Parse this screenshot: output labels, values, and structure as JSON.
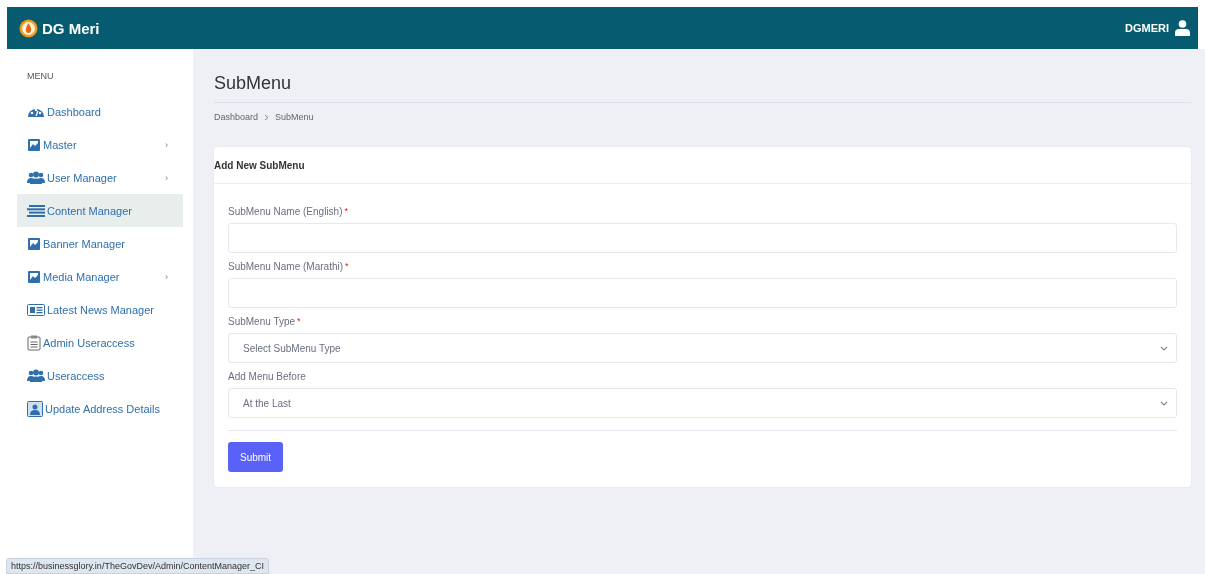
{
  "topbar": {
    "brand": "DG Meri",
    "user": "DGMERI"
  },
  "sidebar": {
    "heading": "MENU",
    "items": [
      {
        "label": "Dashboard",
        "kind": "gauge",
        "selected": false
      },
      {
        "label": "Master",
        "kind": "doc",
        "selected": false,
        "arrow": "›"
      },
      {
        "label": "User Manager",
        "kind": "users",
        "selected": false,
        "arrow": "›"
      },
      {
        "label": "Content Manager",
        "kind": "lines",
        "selected": true
      },
      {
        "label": "Banner Manager",
        "kind": "doc",
        "selected": false
      },
      {
        "label": "Media Manager",
        "kind": "doc",
        "selected": false,
        "arrow": "›"
      },
      {
        "label": "Latest News Manager",
        "kind": "news",
        "selected": false
      },
      {
        "label": "Admin Useraccess",
        "kind": "clipboard",
        "selected": false
      },
      {
        "label": "Useraccess",
        "kind": "users",
        "selected": false
      },
      {
        "label": "Update Address Details",
        "kind": "badge",
        "selected": false
      }
    ]
  },
  "page": {
    "title": "SubMenu",
    "breadcrumb": [
      {
        "label": "Dashboard"
      },
      {
        "label": "SubMenu"
      }
    ]
  },
  "form": {
    "title": "Add New SubMenu",
    "fields": [
      {
        "kind": "text",
        "label": "SubMenu Name (English)",
        "required_mark": "*"
      },
      {
        "kind": "text",
        "label": "SubMenu Name (Marathi)",
        "required_mark": "*"
      },
      {
        "kind": "select",
        "label": "SubMenu Type",
        "required_mark": "*",
        "value": "Select SubMenu Type"
      },
      {
        "kind": "select",
        "label": "Add Menu Before",
        "value": "At the Last"
      }
    ],
    "submit": "Submit"
  },
  "status_bar": {
    "url": "https://businessglory.in/TheGovDev/Admin/ContentManager_CI"
  }
}
